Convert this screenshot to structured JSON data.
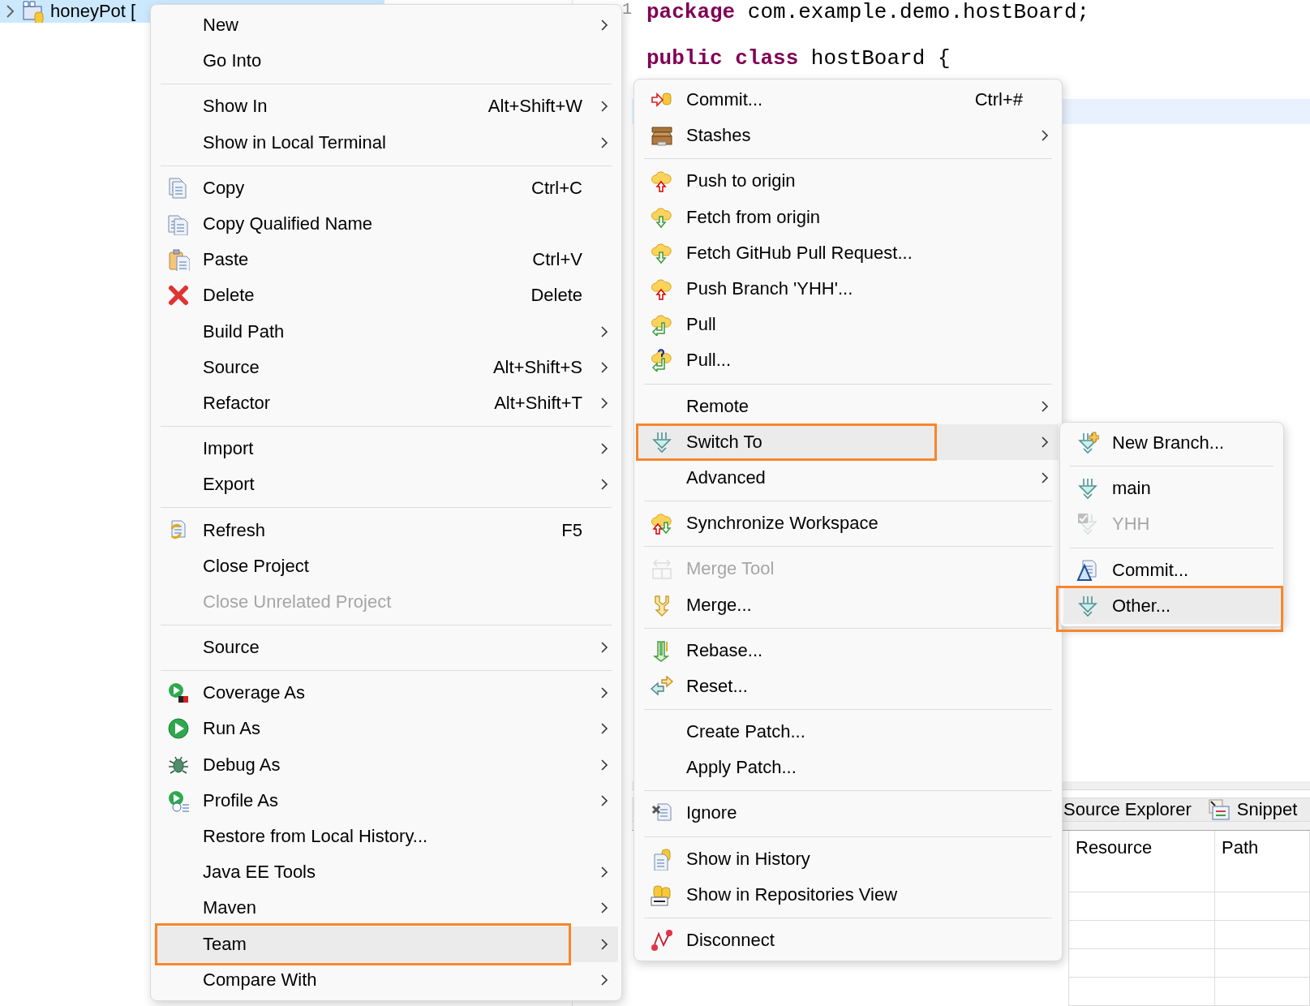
{
  "tree": {
    "items": [
      {
        "label": "honeyPot [",
        "selected": true
      }
    ]
  },
  "editor": {
    "line_numbers": [
      "1"
    ],
    "lines": [
      "**package** com.example.demo.hostBoard;",
      "**public** **class** hostBoard {"
    ],
    "current_line_highlight": true
  },
  "panel": {
    "tabs": [
      {
        "label": "Source Explorer"
      },
      {
        "label": "Snippet"
      }
    ],
    "columns": [
      "Resource",
      "Path"
    ]
  },
  "menus": [
    {
      "items": [
        {
          "kind": "item",
          "label": "New",
          "submenu": true,
          "selected": false,
          "outlined": false,
          "disabled": false
        },
        {
          "kind": "item",
          "label": "Go Into",
          "submenu": false,
          "selected": false,
          "outlined": false,
          "disabled": false
        },
        {
          "kind": "separator"
        },
        {
          "kind": "item",
          "label": "Show In",
          "shortcut": "Alt+Shift+W",
          "submenu": true,
          "selected": false,
          "outlined": false,
          "disabled": false
        },
        {
          "kind": "item",
          "label": "Show in Local Terminal",
          "submenu": true,
          "selected": false,
          "outlined": false,
          "disabled": false
        },
        {
          "kind": "separator"
        },
        {
          "kind": "item",
          "label": "Copy",
          "shortcut": "Ctrl+C",
          "submenu": false,
          "selected": false,
          "outlined": false,
          "disabled": false
        },
        {
          "kind": "item",
          "label": "Copy Qualified Name",
          "submenu": false,
          "selected": false,
          "outlined": false,
          "disabled": false
        },
        {
          "kind": "item",
          "label": "Paste",
          "shortcut": "Ctrl+V",
          "submenu": false,
          "selected": false,
          "outlined": false,
          "disabled": false
        },
        {
          "kind": "item",
          "label": "Delete",
          "shortcut": "Delete",
          "submenu": false,
          "selected": false,
          "outlined": false,
          "disabled": false
        },
        {
          "kind": "item",
          "label": "Build Path",
          "submenu": true,
          "selected": false,
          "outlined": false,
          "disabled": false
        },
        {
          "kind": "item",
          "label": "Source",
          "shortcut": "Alt+Shift+S",
          "submenu": true,
          "selected": false,
          "outlined": false,
          "disabled": false
        },
        {
          "kind": "item",
          "label": "Refactor",
          "shortcut": "Alt+Shift+T",
          "submenu": true,
          "selected": false,
          "outlined": false,
          "disabled": false
        },
        {
          "kind": "separator"
        },
        {
          "kind": "item",
          "label": "Import",
          "submenu": true,
          "selected": false,
          "outlined": false,
          "disabled": false
        },
        {
          "kind": "item",
          "label": "Export",
          "submenu": true,
          "selected": false,
          "outlined": false,
          "disabled": false
        },
        {
          "kind": "separator"
        },
        {
          "kind": "item",
          "label": "Refresh",
          "shortcut": "F5",
          "submenu": false,
          "selected": false,
          "outlined": false,
          "disabled": false
        },
        {
          "kind": "item",
          "label": "Close Project",
          "submenu": false,
          "selected": false,
          "outlined": false,
          "disabled": false
        },
        {
          "kind": "item",
          "label": "Close Unrelated Project",
          "submenu": false,
          "selected": false,
          "outlined": false,
          "disabled": true
        },
        {
          "kind": "separator"
        },
        {
          "kind": "item",
          "label": "Source",
          "submenu": true,
          "selected": false,
          "outlined": false,
          "disabled": false
        },
        {
          "kind": "separator"
        },
        {
          "kind": "item",
          "label": "Coverage As",
          "submenu": true,
          "selected": false,
          "outlined": false,
          "disabled": false
        },
        {
          "kind": "item",
          "label": "Run As",
          "submenu": true,
          "selected": false,
          "outlined": false,
          "disabled": false
        },
        {
          "kind": "item",
          "label": "Debug As",
          "submenu": true,
          "selected": false,
          "outlined": false,
          "disabled": false
        },
        {
          "kind": "item",
          "label": "Profile As",
          "submenu": true,
          "selected": false,
          "outlined": false,
          "disabled": false
        },
        {
          "kind": "item",
          "label": "Restore from Local History...",
          "submenu": false,
          "selected": false,
          "outlined": false,
          "disabled": false
        },
        {
          "kind": "item",
          "label": "Java EE Tools",
          "submenu": true,
          "selected": false,
          "outlined": false,
          "disabled": false
        },
        {
          "kind": "item",
          "label": "Maven",
          "submenu": true,
          "selected": false,
          "outlined": false,
          "disabled": false
        },
        {
          "kind": "item",
          "label": "Team",
          "submenu": true,
          "selected": true,
          "outlined": true,
          "disabled": false
        },
        {
          "kind": "item",
          "label": "Compare With",
          "submenu": true,
          "selected": false,
          "outlined": false,
          "disabled": false
        }
      ]
    },
    {
      "items": [
        {
          "kind": "item",
          "label": "Commit...",
          "shortcut": "Ctrl+#",
          "submenu": false,
          "selected": false,
          "outlined": false,
          "disabled": false
        },
        {
          "kind": "item",
          "label": "Stashes",
          "submenu": true,
          "selected": false,
          "outlined": false,
          "disabled": false
        },
        {
          "kind": "separator"
        },
        {
          "kind": "item",
          "label": "Push to origin",
          "submenu": false,
          "selected": false,
          "outlined": false,
          "disabled": false
        },
        {
          "kind": "item",
          "label": "Fetch from origin",
          "submenu": false,
          "selected": false,
          "outlined": false,
          "disabled": false
        },
        {
          "kind": "item",
          "label": "Fetch GitHub Pull Request...",
          "submenu": false,
          "selected": false,
          "outlined": false,
          "disabled": false
        },
        {
          "kind": "item",
          "label": "Push Branch 'YHH'...",
          "submenu": false,
          "selected": false,
          "outlined": false,
          "disabled": false
        },
        {
          "kind": "item",
          "label": "Pull",
          "submenu": false,
          "selected": false,
          "outlined": false,
          "disabled": false
        },
        {
          "kind": "item",
          "label": "Pull...",
          "submenu": false,
          "selected": false,
          "outlined": false,
          "disabled": false
        },
        {
          "kind": "separator"
        },
        {
          "kind": "item",
          "label": "Remote",
          "submenu": true,
          "selected": false,
          "outlined": false,
          "disabled": false
        },
        {
          "kind": "item",
          "label": "Switch To",
          "submenu": true,
          "selected": true,
          "outlined": true,
          "disabled": false
        },
        {
          "kind": "item",
          "label": "Advanced",
          "submenu": true,
          "selected": false,
          "outlined": false,
          "disabled": false
        },
        {
          "kind": "separator"
        },
        {
          "kind": "item",
          "label": "Synchronize Workspace",
          "submenu": false,
          "selected": false,
          "outlined": false,
          "disabled": false
        },
        {
          "kind": "separator"
        },
        {
          "kind": "item",
          "label": "Merge Tool",
          "submenu": false,
          "selected": false,
          "outlined": false,
          "disabled": true
        },
        {
          "kind": "item",
          "label": "Merge...",
          "submenu": false,
          "selected": false,
          "outlined": false,
          "disabled": false
        },
        {
          "kind": "separator"
        },
        {
          "kind": "item",
          "label": "Rebase...",
          "submenu": false,
          "selected": false,
          "outlined": false,
          "disabled": false
        },
        {
          "kind": "item",
          "label": "Reset...",
          "submenu": false,
          "selected": false,
          "outlined": false,
          "disabled": false
        },
        {
          "kind": "separator"
        },
        {
          "kind": "item",
          "label": "Create Patch...",
          "submenu": false,
          "selected": false,
          "outlined": false,
          "disabled": false
        },
        {
          "kind": "item",
          "label": "Apply Patch...",
          "submenu": false,
          "selected": false,
          "outlined": false,
          "disabled": false
        },
        {
          "kind": "separator"
        },
        {
          "kind": "item",
          "label": "Ignore",
          "submenu": false,
          "selected": false,
          "outlined": false,
          "disabled": false
        },
        {
          "kind": "separator"
        },
        {
          "kind": "item",
          "label": "Show in History",
          "submenu": false,
          "selected": false,
          "outlined": false,
          "disabled": false
        },
        {
          "kind": "item",
          "label": "Show in Repositories View",
          "submenu": false,
          "selected": false,
          "outlined": false,
          "disabled": false
        },
        {
          "kind": "separator"
        },
        {
          "kind": "item",
          "label": "Disconnect",
          "submenu": false,
          "selected": false,
          "outlined": false,
          "disabled": false
        }
      ]
    },
    {
      "items": [
        {
          "kind": "item",
          "label": "New Branch...",
          "submenu": false,
          "selected": false,
          "outlined": false,
          "disabled": false
        },
        {
          "kind": "separator"
        },
        {
          "kind": "item",
          "label": "main",
          "submenu": false,
          "selected": false,
          "outlined": false,
          "disabled": false
        },
        {
          "kind": "item",
          "label": "YHH",
          "submenu": false,
          "selected": false,
          "outlined": false,
          "disabled": true
        },
        {
          "kind": "separator"
        },
        {
          "kind": "item",
          "label": "Commit...",
          "submenu": false,
          "selected": false,
          "outlined": false,
          "disabled": false
        },
        {
          "kind": "item",
          "label": "Other...",
          "submenu": false,
          "selected": true,
          "outlined": true,
          "disabled": false
        }
      ]
    }
  ]
}
